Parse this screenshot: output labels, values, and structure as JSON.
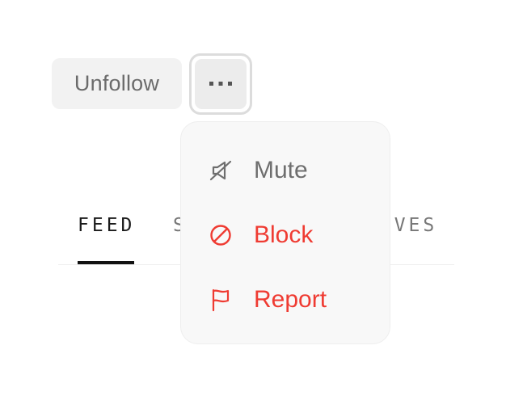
{
  "actions": {
    "unfollow_label": "Unfollow",
    "more_label": "•••"
  },
  "tabs": [
    {
      "label": "FEED",
      "active": true
    },
    {
      "label": "S"
    },
    {
      "label": "TIVES"
    }
  ],
  "menu": {
    "items": [
      {
        "label": "Mute",
        "icon": "mute-icon",
        "color": "#6e6e6e"
      },
      {
        "label": "Block",
        "icon": "block-icon",
        "color": "#ef3b32"
      },
      {
        "label": "Report",
        "icon": "flag-icon",
        "color": "#ef3b32"
      }
    ]
  },
  "colors": {
    "danger": "#ef3b32",
    "neutral_text": "#6e6e6e",
    "active_tab": "#111111"
  }
}
